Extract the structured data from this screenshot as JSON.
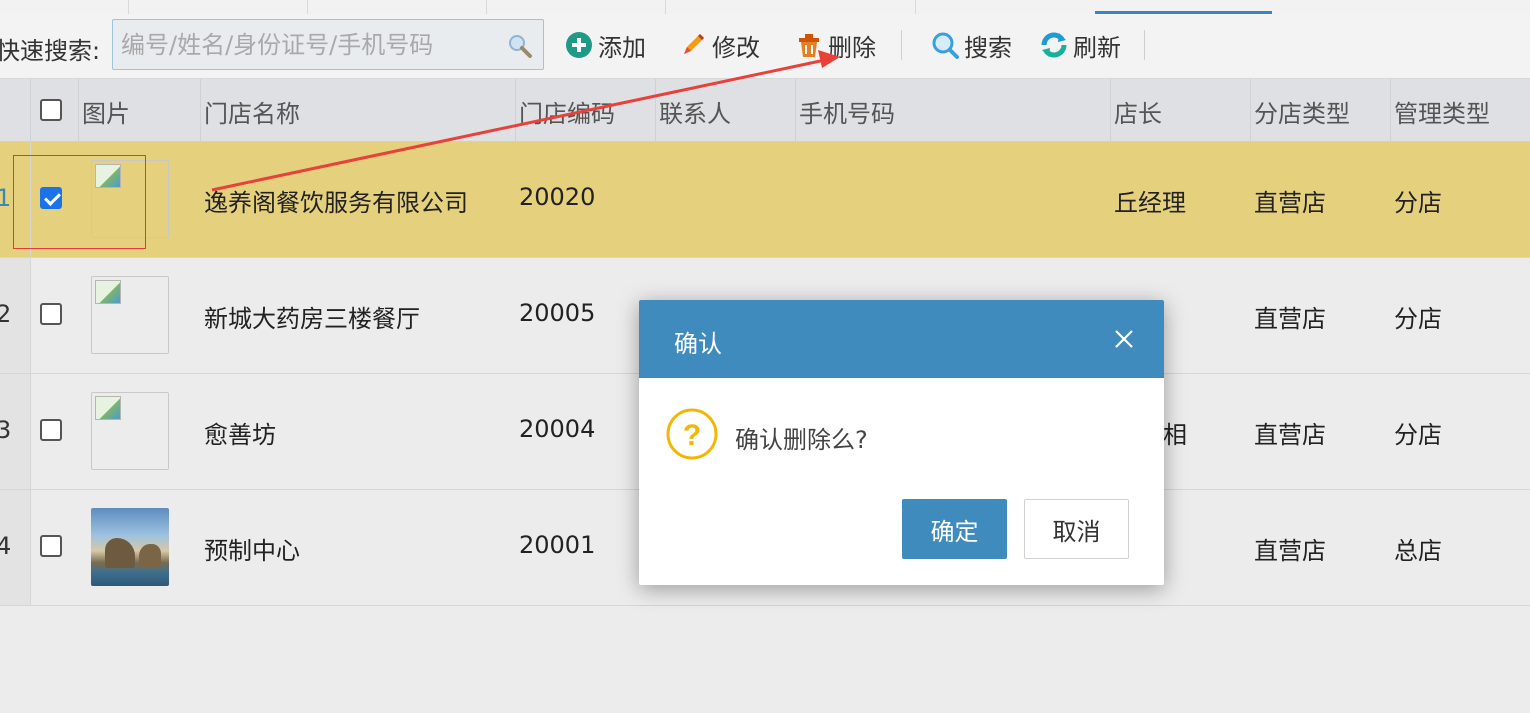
{
  "toolbar": {
    "quick_search_label": "快速搜索:",
    "search_placeholder": "编号/姓名/身份证号/手机号码",
    "add_label": "添加",
    "edit_label": "修改",
    "delete_label": "删除",
    "search_label": "搜索",
    "refresh_label": "刷新",
    "icons": [
      "search-icon",
      "add-circle-icon",
      "pencil-icon",
      "trash-icon",
      "magnifier-icon",
      "refresh-icon"
    ]
  },
  "grid": {
    "columns": {
      "image": "图片",
      "store_name": "门店名称",
      "store_code": "门店编码",
      "contact": "联系人",
      "phone": "手机号码",
      "manager": "店长",
      "branch_type": "分店类型",
      "mgmt_type": "管理类型"
    },
    "rows": [
      {
        "num": "1",
        "checked": true,
        "image": "broken",
        "store_name": "逸养阁餐饮服务有限公司",
        "store_code": "20020",
        "contact": "",
        "phone": "",
        "manager": "丘经理",
        "branch_type": "直营店",
        "mgmt_type": "分店"
      },
      {
        "num": "2",
        "checked": false,
        "image": "broken",
        "store_name": "新城大药房三楼餐厅",
        "store_code": "20005",
        "contact": "",
        "phone": "",
        "manager": "",
        "branch_type": "直营店",
        "mgmt_type": "分店"
      },
      {
        "num": "3",
        "checked": false,
        "image": "broken",
        "store_name": "愈善坊",
        "store_code": "20004",
        "contact": "",
        "phone": "",
        "manager": "相",
        "branch_type": "直营店",
        "mgmt_type": "分店"
      },
      {
        "num": "4",
        "checked": false,
        "image": "photo",
        "store_name": "预制中心",
        "store_code": "20001",
        "contact": "",
        "phone": "",
        "manager": "",
        "branch_type": "直营店",
        "mgmt_type": "总店"
      }
    ]
  },
  "dialog": {
    "title": "确认",
    "message": "确认删除么?",
    "ok_label": "确定",
    "cancel_label": "取消"
  },
  "colors": {
    "accent": "#3f8bbd",
    "selected_row": "#e5d07e",
    "annotation": "#e03a3a",
    "warning_icon": "#f2b705"
  }
}
